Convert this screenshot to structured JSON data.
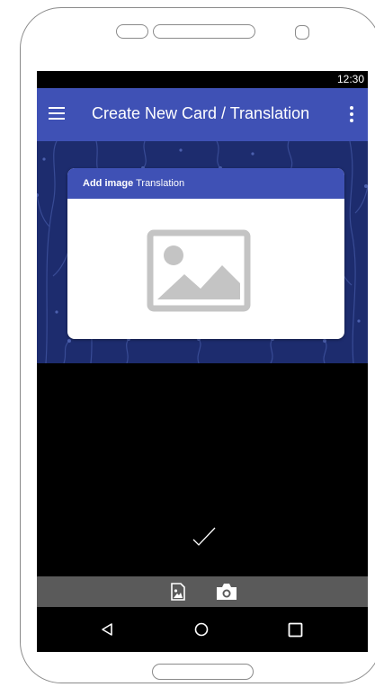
{
  "status_bar": {
    "time": "12:30"
  },
  "app_bar": {
    "title": "Create New Card / Translation",
    "menu_icon": "hamburger-menu-icon",
    "overflow_icon": "more-vert-icon",
    "color": "#3f51b5"
  },
  "card": {
    "header_bold": "Add image",
    "header_rest": " Translation",
    "placeholder_icon": "image-placeholder-icon"
  },
  "actions": {
    "confirm_icon": "checkmark-icon",
    "gallery_icon": "gallery-icon",
    "camera_icon": "camera-icon"
  },
  "nav": {
    "back_icon": "back-triangle-icon",
    "home_icon": "home-circle-icon",
    "recent_icon": "recent-apps-icon"
  },
  "colors": {
    "accent": "#3f51b5",
    "pattern_background": "#1d2c6e",
    "toolbar": "#5a5a5a"
  }
}
